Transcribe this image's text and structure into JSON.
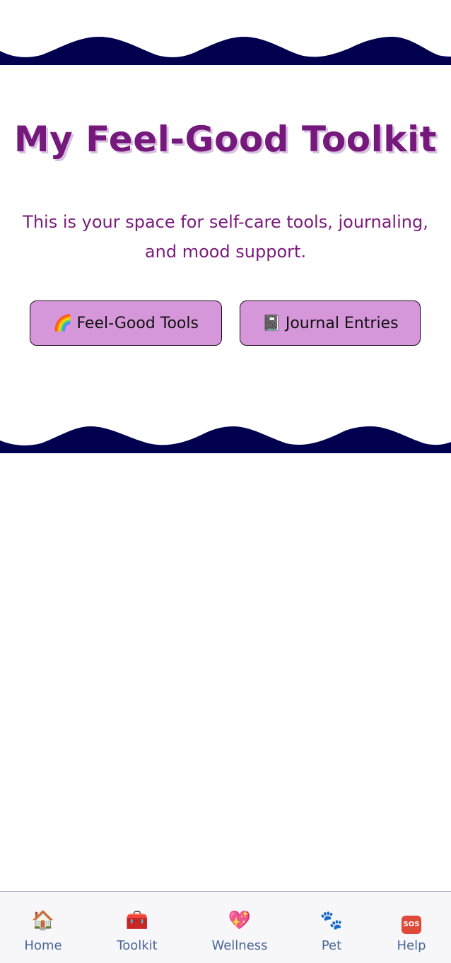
{
  "header": {
    "title": "My Feel-Good Toolkit",
    "subtitle": "This is your space for self-care tools, journaling, and mood support."
  },
  "actions": {
    "tools_icon": "🌈",
    "tools_label": "Feel-Good Tools",
    "journal_icon": "📓",
    "journal_label": "Journal Entries"
  },
  "nav": {
    "items": [
      {
        "icon": "🏠",
        "label": "Home"
      },
      {
        "icon": "🧰",
        "label": "Toolkit"
      },
      {
        "icon": "💖",
        "label": "Wellness"
      },
      {
        "icon": "🐾",
        "label": "Pet"
      },
      {
        "icon": "SOS",
        "label": "Help"
      }
    ]
  },
  "colors": {
    "wave": "#00004f",
    "title": "#75197c",
    "button_bg": "#d597d9",
    "nav_label": "#4a6795"
  }
}
